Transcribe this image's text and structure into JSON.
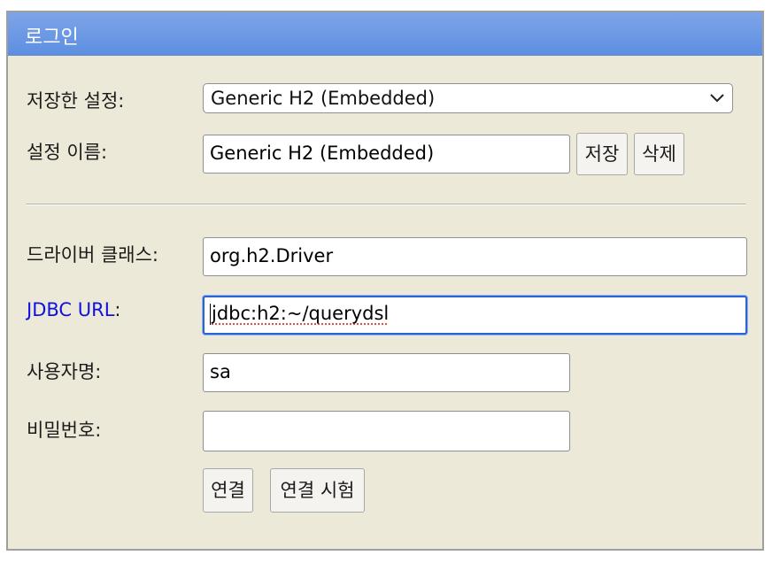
{
  "dialog": {
    "title": "로그인"
  },
  "form": {
    "saved_settings": {
      "label": "저장한 설정:",
      "selected": "Generic H2 (Embedded)"
    },
    "setting_name": {
      "label": "설정 이름:",
      "value": "Generic H2 (Embedded)",
      "save_label": "저장",
      "delete_label": "삭제"
    },
    "driver_class": {
      "label": "드라이버 클래스:",
      "value": "org.h2.Driver"
    },
    "jdbc_url": {
      "label": "JDBC URL",
      "colon": ":",
      "value": "jdbc:h2:~/querydsl"
    },
    "username": {
      "label": "사용자명:",
      "value": "sa"
    },
    "password": {
      "label": "비밀번호:",
      "value": ""
    },
    "actions": {
      "connect_label": "연결",
      "test_label": "연결 시험"
    }
  },
  "colors": {
    "titlebar": "#6f9be5",
    "panel": "#ece9d8",
    "link_label": "#1010e0",
    "focus_ring": "#2a63d4"
  },
  "icons": {
    "select_arrow": "chevron-down-icon"
  }
}
